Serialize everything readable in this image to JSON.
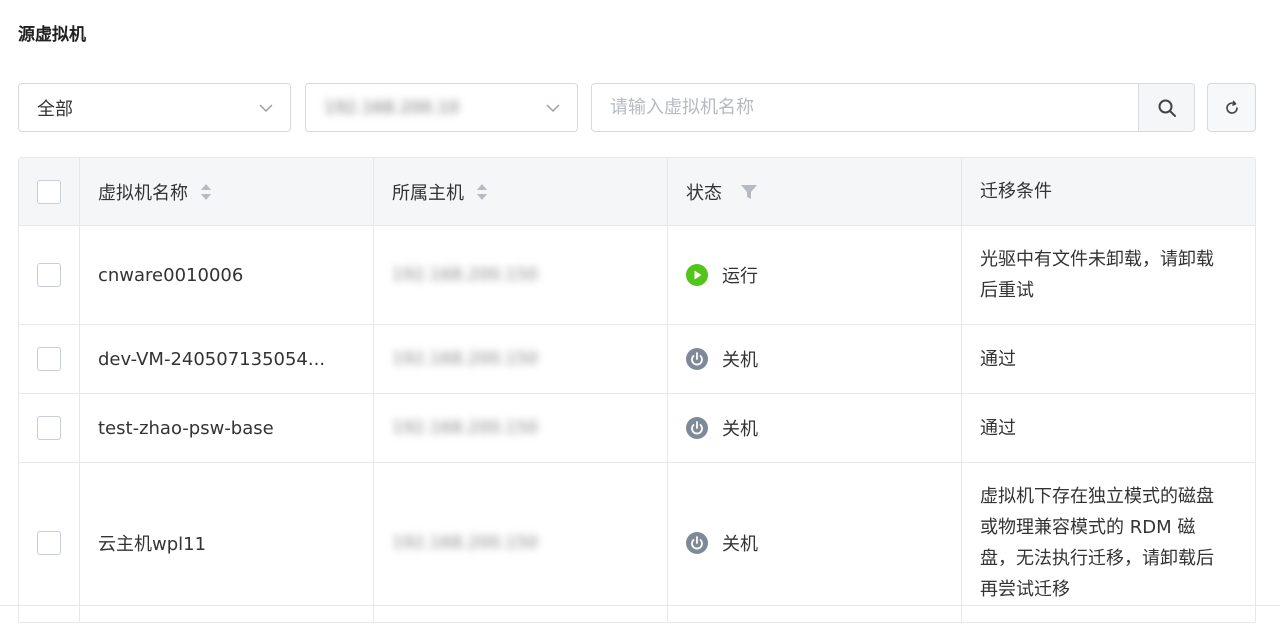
{
  "section_title": "源虚拟机",
  "filters": {
    "type_select": "全部",
    "host_select": "192.168.200.10",
    "search_placeholder": "请输入虚拟机名称"
  },
  "table": {
    "headers": {
      "name": "虚拟机名称",
      "host": "所属主机",
      "status": "状态",
      "condition": "迁移条件"
    },
    "rows": [
      {
        "name": "cnware0010006",
        "host": "192.168.200.150",
        "status": "运行",
        "status_kind": "running",
        "condition": "光驱中有文件未卸载，请卸载后重试"
      },
      {
        "name": "dev-VM-240507135054...",
        "host": "192.168.200.150",
        "status": "关机",
        "status_kind": "off",
        "condition": "通过"
      },
      {
        "name": "test-zhao-psw-base",
        "host": "192.168.200.150",
        "status": "关机",
        "status_kind": "off",
        "condition": "通过"
      },
      {
        "name": "云主机wpl11",
        "host": "192.168.200.150",
        "status": "关机",
        "status_kind": "off",
        "condition": "虚拟机下存在独立模式的磁盘或物理兼容模式的 RDM 磁盘，无法执行迁移，请卸载后再尝试迁移"
      }
    ]
  },
  "colors": {
    "running": "#52c41a",
    "off": "#7e8a98"
  }
}
